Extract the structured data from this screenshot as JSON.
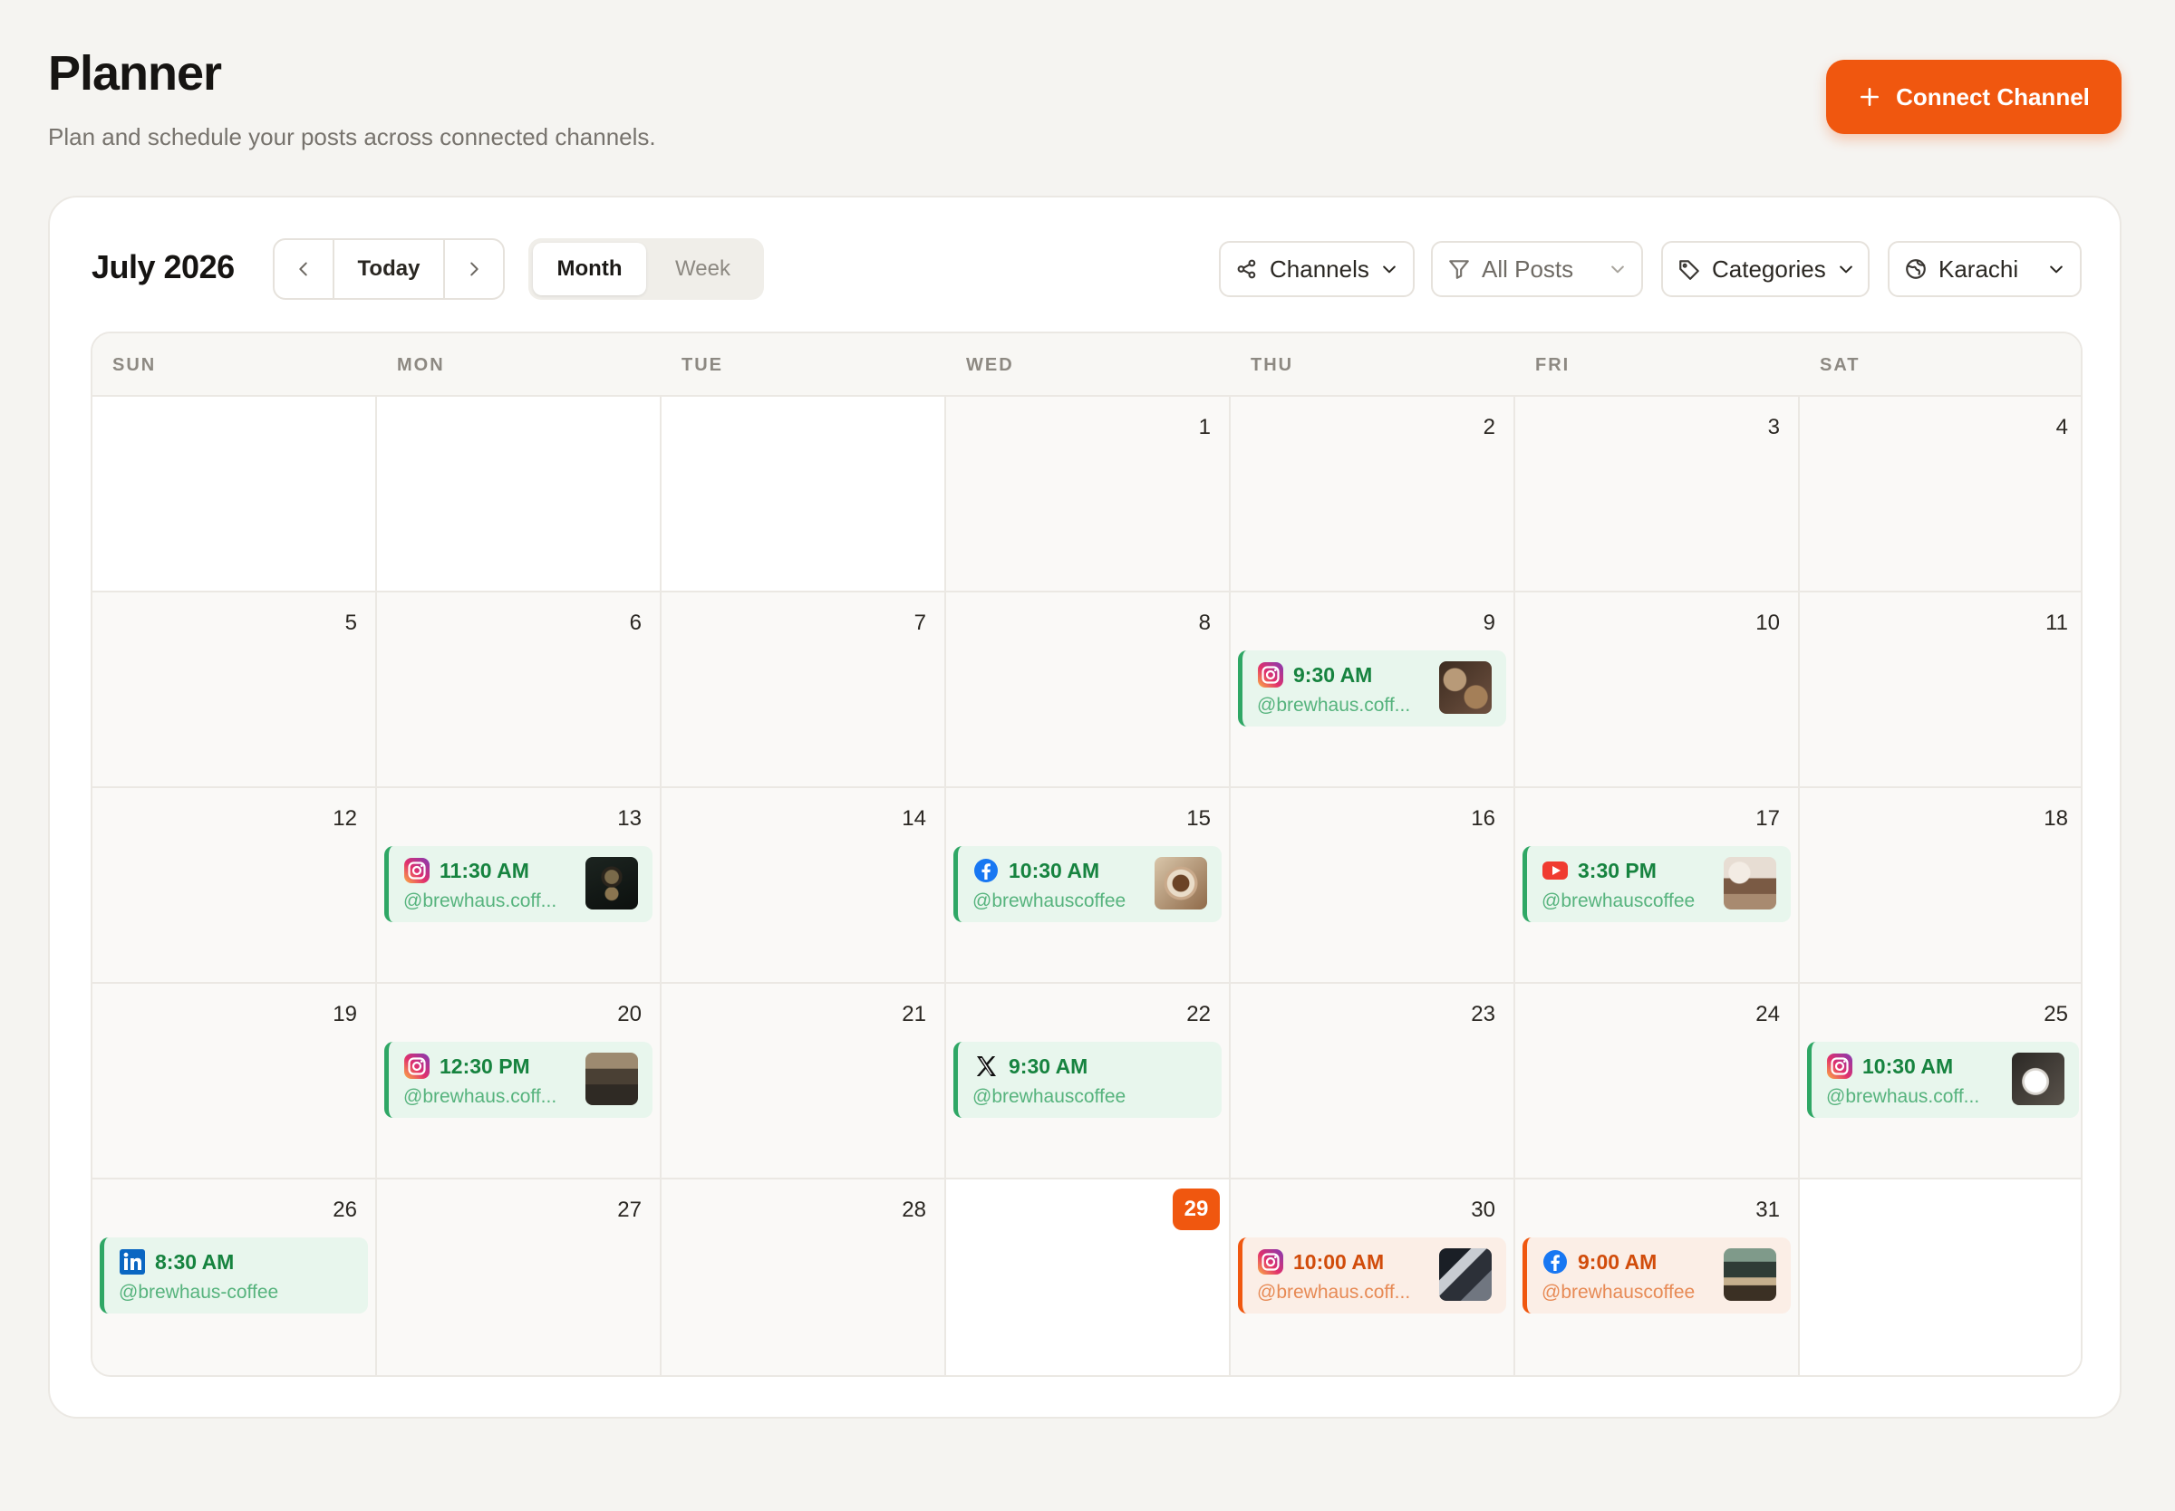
{
  "header": {
    "title": "Planner",
    "subtitle": "Plan and schedule your posts across connected channels.",
    "connect_label": "Connect Channel"
  },
  "toolbar": {
    "month_label": "July 2026",
    "today_label": "Today",
    "view_month": "Month",
    "view_week": "Week",
    "active_view": "Month",
    "filters": {
      "channels": "Channels",
      "posts": "All Posts",
      "categories": "Categories",
      "timezone": "Karachi"
    }
  },
  "calendar": {
    "weekdays": [
      "SUN",
      "MON",
      "TUE",
      "WED",
      "THU",
      "FRI",
      "SAT"
    ],
    "first_weekday_index": 3,
    "days_in_month": 31,
    "today": 29,
    "colors": {
      "accent": "#f0570f",
      "scheduled_bg": "#e8f6ed",
      "scheduled_border": "#2fa765",
      "past_bg": "#fbeee6"
    },
    "posts": [
      {
        "day": 9,
        "channel": "instagram-icon",
        "time": "9:30 AM",
        "handle": "@brewhaus.coff...",
        "thumb": true,
        "status": "scheduled"
      },
      {
        "day": 13,
        "channel": "instagram-icon",
        "time": "11:30 AM",
        "handle": "@brewhaus.coff...",
        "thumb": true,
        "status": "scheduled"
      },
      {
        "day": 15,
        "channel": "facebook-icon",
        "time": "10:30 AM",
        "handle": "@brewhauscoffee",
        "thumb": true,
        "status": "scheduled"
      },
      {
        "day": 17,
        "channel": "youtube-icon",
        "time": "3:30 PM",
        "handle": "@brewhauscoffee",
        "thumb": true,
        "status": "scheduled"
      },
      {
        "day": 20,
        "channel": "instagram-icon",
        "time": "12:30 PM",
        "handle": "@brewhaus.coff...",
        "thumb": true,
        "status": "scheduled"
      },
      {
        "day": 22,
        "channel": "x-icon",
        "time": "9:30 AM",
        "handle": "@brewhauscoffee",
        "thumb": false,
        "status": "scheduled"
      },
      {
        "day": 25,
        "channel": "instagram-icon",
        "time": "10:30 AM",
        "handle": "@brewhaus.coff...",
        "thumb": true,
        "status": "scheduled"
      },
      {
        "day": 26,
        "channel": "linkedin-icon",
        "time": "8:30 AM",
        "handle": "@brewhaus-coffee",
        "thumb": false,
        "status": "scheduled"
      },
      {
        "day": 30,
        "channel": "instagram-icon",
        "time": "10:00 AM",
        "handle": "@brewhaus.coff...",
        "thumb": true,
        "status": "past"
      },
      {
        "day": 31,
        "channel": "facebook-icon",
        "time": "9:00 AM",
        "handle": "@brewhauscoffee",
        "thumb": true,
        "status": "past"
      }
    ]
  }
}
